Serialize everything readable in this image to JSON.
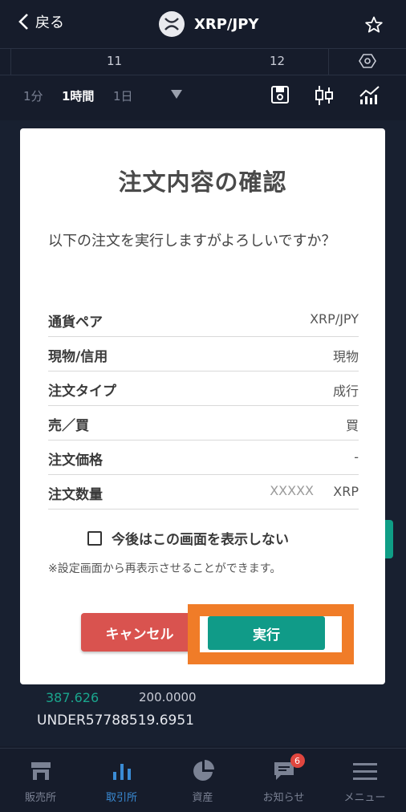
{
  "header": {
    "back_label": "戻る",
    "pair": "XRP/JPY"
  },
  "timebar": {
    "labels": [
      "11",
      "12"
    ]
  },
  "toolbar": {
    "intervals": [
      "1分",
      "1時間",
      "1日"
    ]
  },
  "background": {
    "price1": "387.626",
    "amount1": "200.0000",
    "under": "UNDER57788519.6951"
  },
  "modal": {
    "title": "注文内容の確認",
    "message": "以下の注文を実行しますがよろしいですか？",
    "rows": [
      {
        "key": "通貨ペア",
        "value": "XRP/JPY"
      },
      {
        "key": "現物/信用",
        "value": "現物"
      },
      {
        "key": "注文タイプ",
        "value": "成行"
      },
      {
        "key": "売／買",
        "value": "買"
      },
      {
        "key": "注文価格",
        "value": "-"
      },
      {
        "key": "注文数量",
        "value": "XRP",
        "quantity": "XXXXX"
      }
    ],
    "checkbox_label": "今後はこの画面を表示しない",
    "note": "※設定画面から再表示させることができます。",
    "cancel_label": "キャンセル",
    "execute_label": "実行"
  },
  "nav": {
    "items": [
      {
        "label": "販売所",
        "icon": "store-icon"
      },
      {
        "label": "取引所",
        "icon": "bar-chart-icon"
      },
      {
        "label": "資産",
        "icon": "pie-chart-icon"
      },
      {
        "label": "お知らせ",
        "icon": "message-icon",
        "badge": "6"
      },
      {
        "label": "メニュー",
        "icon": "menu-icon"
      }
    ],
    "active_color": "#3a8cd6"
  },
  "colors": {
    "execute": "#109b88",
    "cancel": "#d9534f",
    "highlight": "#f07c28"
  }
}
